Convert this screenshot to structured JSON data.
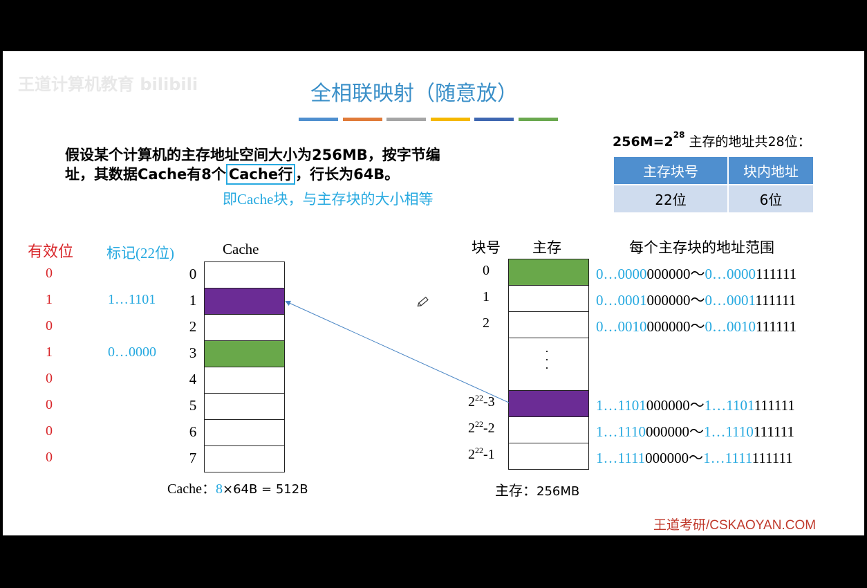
{
  "watermark": "王道计算机教育 bilibili",
  "title": "全相联映射（随意放）",
  "bar_colors": [
    "#4f8fcf",
    "#e07b39",
    "#a5a5a5",
    "#f5b800",
    "#3f67b1",
    "#6aa84f"
  ],
  "problem": {
    "line1_a": "假设某个计算机的主存地址空间大小为256MB，按",
    "line1_b": "字节",
    "line1_c": "编",
    "line2_a": "址，其数据Cache有8个",
    "line2_boxed": "Cache行",
    "line2_c": "，行长为64B。",
    "note": "即Cache块，与主存块的大小相等"
  },
  "address_info": {
    "prefix": "256M=2",
    "exp": "28",
    "suffix": " 主存的地址共28位：",
    "headers": [
      "主存块号",
      "块内地址"
    ],
    "values": [
      "22位",
      "6位"
    ]
  },
  "cache": {
    "valid_header": "有效位",
    "tag_header": "标记(22位)",
    "cache_header": "Cache",
    "valid_bits": [
      "0",
      "1",
      "0",
      "1",
      "0",
      "0",
      "0",
      "0"
    ],
    "tags": [
      "",
      "1…1101",
      "",
      "0…0000",
      "",
      "",
      "",
      ""
    ],
    "indices": [
      "0",
      "1",
      "2",
      "3",
      "4",
      "5",
      "6",
      "7"
    ],
    "fills": [
      "white",
      "purple",
      "white",
      "green",
      "white",
      "white",
      "white",
      "white"
    ],
    "size_label": "Cache：",
    "size_n": "8",
    "size_rest": "×64B = 512B"
  },
  "memory": {
    "block_header": "块号",
    "mem_header": "主存",
    "range_header": "每个主存块的地址范围",
    "ellipsis": "·\n·\n·",
    "rows": [
      {
        "base": "",
        "exp": "",
        "idx": "0",
        "fill": "green",
        "tag_a": "0…0000",
        "off_a": "000000",
        "sep": "～",
        "tag_b": "0…0000",
        "off_b": "111111"
      },
      {
        "base": "",
        "exp": "",
        "idx": "1",
        "fill": "white",
        "tag_a": "0…0001",
        "off_a": "000000",
        "sep": "～",
        "tag_b": "0…0001",
        "off_b": "111111"
      },
      {
        "base": "",
        "exp": "",
        "idx": "2",
        "fill": "white",
        "tag_a": "0…0010",
        "off_a": "000000",
        "sep": "～",
        "tag_b": "0…0010",
        "off_b": "111111"
      },
      {
        "base": "2",
        "exp": "22",
        "idx": "-3",
        "fill": "purple",
        "tag_a": "1…1101",
        "off_a": "000000",
        "sep": "～",
        "tag_b": "1…1101",
        "off_b": "111111"
      },
      {
        "base": "2",
        "exp": "22",
        "idx": "-2",
        "fill": "white",
        "tag_a": "1…1110",
        "off_a": "000000",
        "sep": "～",
        "tag_b": "1…1110",
        "off_b": "111111"
      },
      {
        "base": "2",
        "exp": "22",
        "idx": "-1",
        "fill": "white",
        "tag_a": "1…1111",
        "off_a": "000000",
        "sep": "～",
        "tag_b": "1…1111",
        "off_b": "111111"
      }
    ],
    "size_label": "主存：",
    "size_value": "256MB"
  },
  "footer": "王道考研/CSKAOYAN.COM"
}
